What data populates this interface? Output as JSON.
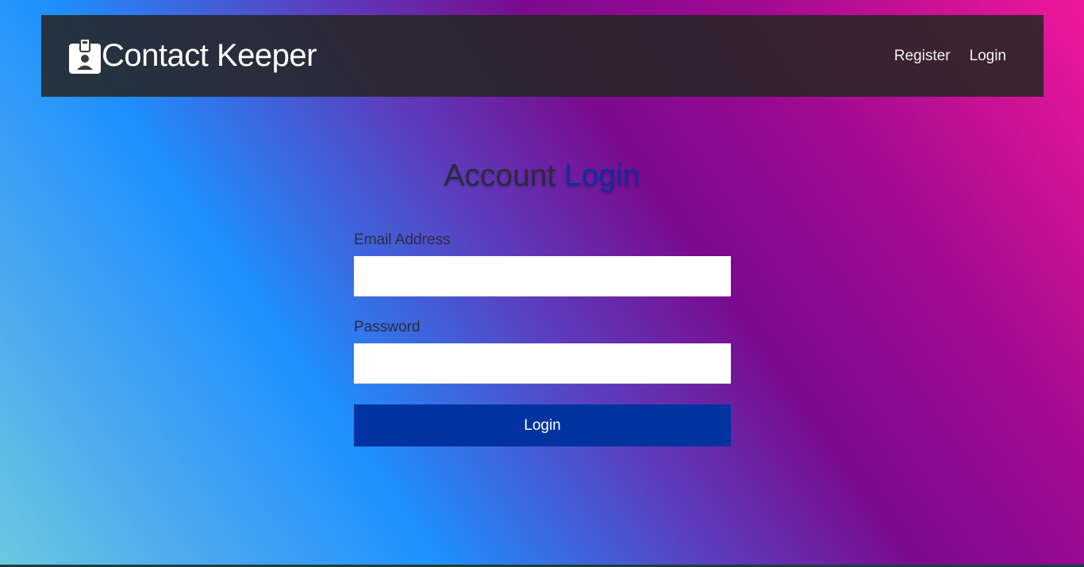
{
  "navbar": {
    "brand_title": "Contact Keeper",
    "brand_icon": "id-badge-icon",
    "links": [
      {
        "label": "Register"
      },
      {
        "label": "Login"
      }
    ]
  },
  "page": {
    "heading_part1": "Account",
    "heading_part2": "Login"
  },
  "form": {
    "email_label": "Email Address",
    "email_value": "",
    "password_label": "Password",
    "password_value": "",
    "submit_label": "Login"
  },
  "colors": {
    "navbar_bg": "#262626",
    "accent": "#0033a0",
    "heading_accent": "#0b2fa0"
  }
}
